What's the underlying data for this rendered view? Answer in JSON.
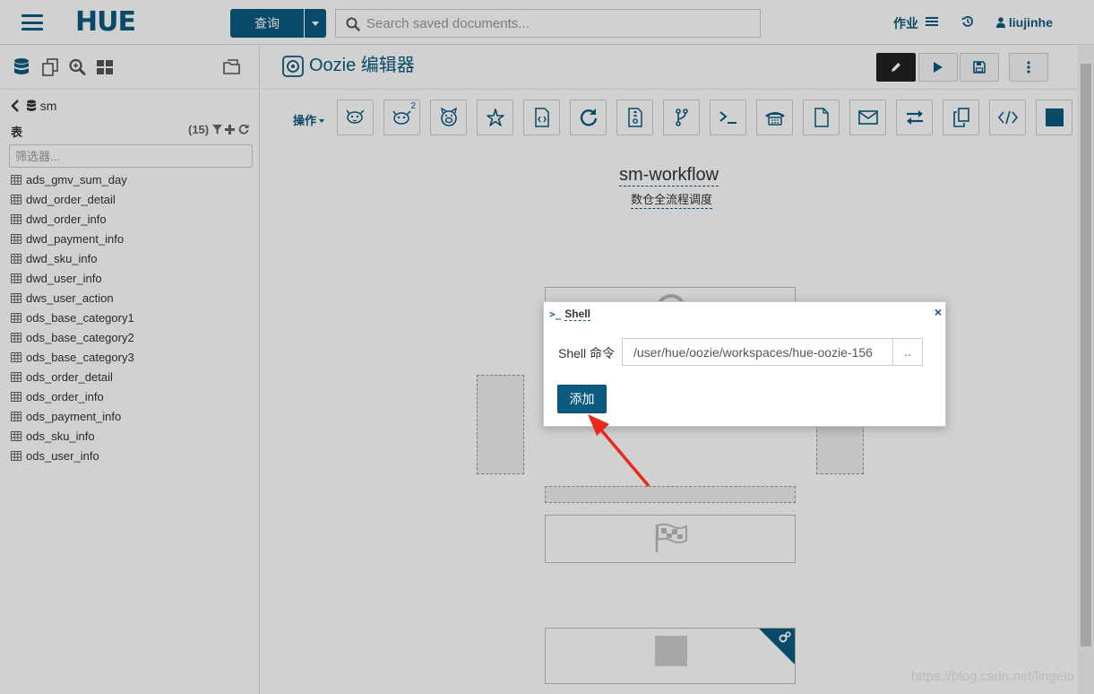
{
  "topbar": {
    "logo": "HUE",
    "query_button": "查询",
    "search_placeholder": "Search saved documents...",
    "jobs_label": "作业",
    "user_label": "liujinhe"
  },
  "sidebar": {
    "database": "sm",
    "tables_label": "表",
    "table_count": "(15)",
    "filter_placeholder": "筛选器...",
    "tables": [
      "ads_gmv_sum_day",
      "dwd_order_detail",
      "dwd_order_info",
      "dwd_payment_info",
      "dwd_sku_info",
      "dwd_user_info",
      "dws_user_action",
      "ods_base_category1",
      "ods_base_category2",
      "ods_base_category3",
      "ods_order_detail",
      "ods_order_info",
      "ods_payment_info",
      "ods_sku_info",
      "ods_user_info"
    ]
  },
  "editor": {
    "title": "Oozie 编辑器",
    "actions_label": "操作",
    "hive2_badge": "2",
    "workflow_name": "sm-workflow",
    "workflow_description": "数仓全流程调度"
  },
  "modal": {
    "title": "Shell",
    "shell_icon": ">_",
    "command_label": "Shell 命令",
    "command_value": "/user/hue/oozie/workspaces/hue-oozie-156",
    "browse_label": "..",
    "add_button": "添加",
    "close_glyph": "×"
  },
  "watermark": "https://blog.csdn.net/lingeio",
  "colors": {
    "accent": "#0b5b80",
    "arrow": "#e8291c"
  }
}
